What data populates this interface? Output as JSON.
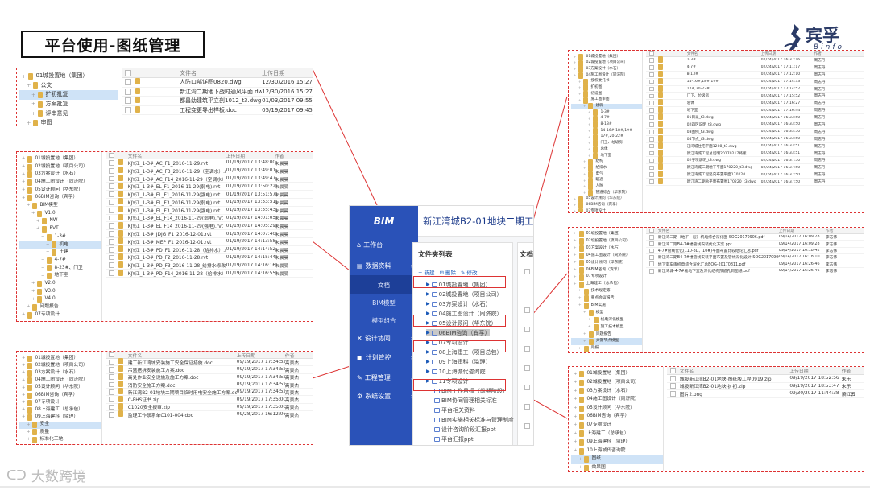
{
  "slide_title": "平台使用-图纸管理",
  "logo": {
    "name": "宾孚",
    "sub": "Binfo"
  },
  "watermark": "大数跨境",
  "colors": {
    "accent_red": "#d33333",
    "sidebar_blue": "#2a52b8",
    "folder": "#e0b24a",
    "selected_row": "#cfe3f7"
  },
  "app": {
    "logo_text": "BIM",
    "project_title": "新江湾城B2-01地块二期工程",
    "menu": [
      {
        "label": "工作台",
        "icon": "home-icon"
      },
      {
        "label": "数据资料",
        "icon": "database-icon"
      },
      {
        "label": "文档",
        "sub": true,
        "active": true
      },
      {
        "label": "BIM模型",
        "sub": true
      },
      {
        "label": "模型组合",
        "sub": true
      },
      {
        "label": "设计协同",
        "icon": "collab-icon"
      },
      {
        "label": "计划管控",
        "icon": "plan-icon"
      },
      {
        "label": "工程管理",
        "icon": "wrench-icon"
      },
      {
        "label": "系统设置",
        "icon": "gear-icon"
      }
    ],
    "tree_title": "文件夹列表",
    "right_title": "文档",
    "tools": {
      "add": "新建",
      "delete": "删除",
      "edit": "修改"
    },
    "nodes": [
      "01城投置地（集团）",
      "02城投置地（项目公司）",
      "03方案设计（水石）",
      "04施工图设计（同济院）",
      "05设计顾问（华东院）",
      "06BIM咨询（宾孚）",
      "07专项设计",
      "08上海建工（项目总包）",
      "09上海建科（监理）",
      "10上海城代咨询院",
      "11专项设计",
      "BIM工作月报（前期阶段）",
      "BIM协同管理相关标准",
      "平台相关资料",
      "BIM实施相关标准与管理制度",
      "设计咨询阶段汇报ppt",
      "平台汇报ppt"
    ]
  },
  "panel1": {
    "tree": [
      "01城投置地（集团）",
      "公文",
      "扩初批复",
      "方案批复",
      "评审意见",
      "审图"
    ],
    "headers": [
      "文件名",
      "上传日期"
    ],
    "rows": [
      [
        "人防口部详图0820.dwg",
        "12/30/2016 15:27:06"
      ],
      [
        "新江湾二期地下战时通风平面.dwg",
        "12/30/2016 15:27:06"
      ],
      [
        "都昌幼建筑平立剖1012_t3.dwg",
        "01/03/2017 09:55:37"
      ],
      [
        "工程变更导出样板.doc",
        "05/19/2017 09:45:14"
      ]
    ]
  },
  "panel2": {
    "tree": [
      "01城投置地（集团）",
      "02城投置地（项目公司）",
      "03方案设计（水石）",
      "04施工图设计（同济院）",
      "05设计顾问（华东院）",
      "06BIM咨询（宾孚）",
      "BIM模型",
      "V1.0",
      "NW",
      "RVT",
      "1-3#",
      "机电",
      "土建",
      "4-7#",
      "8-23#、门卫",
      "地下室",
      "V2.0",
      "V3.0",
      "V4.0",
      "问题报告",
      "07专项设计"
    ],
    "headers": [
      "文件名",
      "上传日期",
      "作者"
    ],
    "rows": [
      [
        "KJY江_1-3#_AC_F1_2016-11-29.rvt",
        "01/19/2017 13:48:00",
        "朱晨曼"
      ],
      [
        "KJY江_1-3#_AC_F3_2016-11-29（空调水）.rvt",
        "01/19/2017 13:49:01",
        "朱晨曼"
      ],
      [
        "KJY江_1-3#_AC_F14_2016-11-29（空调水）.rvt",
        "01/19/2017 13:49:47",
        "朱晨曼"
      ],
      [
        "KJY江_1-3#_EL_F1_2016-11-29(弱电).rvt",
        "01/19/2017 13:50:22",
        "朱晨曼"
      ],
      [
        "KJY江_1-3#_EL_F1_2016-11-29(强电).rvt",
        "01/19/2017 13:51:57",
        "朱晨曼"
      ],
      [
        "KJY江_1-3#_EL_F3_2016-11-29(弱电).rvt",
        "01/19/2017 13:53:51",
        "朱晨曼"
      ],
      [
        "KJY江_1-3#_EL_F3_2016-11-29(强电).rvt",
        "01/19/2017 13:55:43",
        "朱晨曼"
      ],
      [
        "KJY江_1-3#_EL_F14_2016-11-29(弱电).rvt",
        "01/19/2017 14:01:05",
        "朱晨曼"
      ],
      [
        "KJY江_1-3#_EL_F14_2016-11-29(强电).rvt",
        "01/19/2017 14:05:29",
        "朱晨曼"
      ],
      [
        "KJY江_1-3#_JDJG_F1_2016-12-01.rvt",
        "01/19/2017 14:07:40",
        "朱晨曼"
      ],
      [
        "KJY江_1-3#_MEP_F1_2016-12-01.rvt",
        "01/19/2017 14:13:58",
        "朱晨曼"
      ],
      [
        "KJY江_1-3#_PD_F1_2016-11-28（给排水）.rvt",
        "01/19/2017 14:14:52",
        "朱晨曼"
      ],
      [
        "KJY江_1-3#_PD_F2_2016-11-28.rvt",
        "01/19/2017 14:15:44",
        "朱晨曼"
      ],
      [
        "KJY江_1-3#_PD_F3_2016-11-28_给排水修改.rvt",
        "01/19/2017 14:16:16",
        "朱晨曼"
      ],
      [
        "KJY江_1-3#_PD_F14_2016-11-28（给排水）.rvt",
        "01/19/2017 14:16:55",
        "朱晨曼"
      ]
    ]
  },
  "panel3": {
    "tree": [
      "01城投置地（集团）",
      "02城投置地（项目公司）",
      "03方案设计（水石）",
      "04施工图设计（同济院）",
      "05设计顾问（华东院）",
      "06BIM咨询（宾孚）",
      "07专项设计",
      "08上海建工（总承包）",
      "09上海建科（监理）",
      "安全",
      "质量",
      "标准化工地"
    ],
    "headers": [
      "文件名",
      "上传日期",
      "作者"
    ],
    "rows": [
      [
        "建工新江湾城安装施工安全保证措施.doc",
        "09/19/2017 17:34:52",
        "高景杰"
      ],
      [
        "吊篮搭拆安装施工方案.doc",
        "09/19/2017 17:34:52",
        "高景杰"
      ],
      [
        "高处作业安全设施及施工方案.doc",
        "09/19/2017 17:34:52",
        "高景杰"
      ],
      [
        "消防安全施工方案.doc",
        "09/19/2017 17:34:52",
        "高景杰"
      ],
      [
        "新江湾B2-01地块二期项目临时用电安全施工方案.doc",
        "09/19/2017 17:34:52",
        "高景杰"
      ],
      [
        "C-FHS证书.zip",
        "09/19/2017 17:35:00",
        "高景杰"
      ],
      [
        "C1020安全报审.zip",
        "09/19/2017 17:35:00",
        "高景杰"
      ],
      [
        "监理工作联系单C101-004.doc",
        "09/28/2017 16:12:06",
        "高景杰"
      ]
    ]
  },
  "panel4": {
    "tree": [
      "01城投置地（集团）",
      "02城投置地（项目公司）",
      "03方案设计（水石）",
      "04施工图设计（同济院）",
      "授权委托书",
      "扩初图",
      "初设图",
      "施工图审图",
      "建筑",
      "1-3#",
      "4-7#",
      "8-13#",
      "14-16#,18#,19#",
      "17#,20-22#",
      "门卫、垃圾房",
      "总体",
      "地下室",
      "结构",
      "给排水",
      "电气",
      "暖通",
      "人防",
      "管道综合（华东院）",
      "05设计顾问（华东院）",
      "06BIM咨询（宾孚）",
      "07专项设计"
    ],
    "headers": [
      "文件名",
      "上传日期",
      "作者"
    ],
    "rows": [
      [
        "1-3#",
        "02/24/2017 16:37:16",
        "周志丹"
      ],
      [
        "4-7#",
        "02/24/2017 17:11:17",
        "周志丹"
      ],
      [
        "8-13#",
        "02/24/2017 17:12:10",
        "周志丹"
      ],
      [
        "14-16#,18#,19#",
        "02/24/2017 17:14:33",
        "周志丹"
      ],
      [
        "17#,20-22#",
        "02/24/2017 17:14:52",
        "周志丹"
      ],
      [
        "门卫、垃圾房",
        "02/24/2017 17:15:52",
        "周志丹"
      ],
      [
        "总体",
        "02/24/2017 17:16:27",
        "周志丹"
      ],
      [
        "地下室",
        "02/24/2017 17:16:44",
        "周志丹"
      ],
      [
        "01目录_t3.dwg",
        "02/24/2017 16:33:50",
        "周志丹"
      ],
      [
        "02四区说明_t3.dwg",
        "02/24/2017 16:33:50",
        "周志丹"
      ],
      [
        "03图例_t3.dwg",
        "02/24/2017 16:33:50",
        "周志丹"
      ],
      [
        "04节点_t3.dwg",
        "02/24/2017 16:33:50",
        "周志丹"
      ],
      [
        "江湾城住宅平面1208_t3.dwg",
        "02/24/2017 16:33:51",
        "周志丹"
      ],
      [
        "新江湾城工程总说明20170217终版",
        "02/24/2017 16:33:51",
        "周志丹"
      ],
      [
        "02子项说明_t3.dwg",
        "02/24/2017 16:37:50",
        "周志丹"
      ],
      [
        "新江湾城二期地下平面170220_t3.dwg",
        "02/24/2017 16:37:50",
        "周志丹"
      ],
      [
        "新江湾城工程竖向布置平面170220",
        "02/24/2017 16:37:50",
        "周志丹"
      ],
      [
        "新江湾二期总平面布置图170220_t3.dwg",
        "02/24/2017 16:37:50",
        "周志丹"
      ]
    ]
  },
  "panel5": {
    "tree": [
      "01城投置地（集团）",
      "02城投置地（项目公司）",
      "03方案设计（水石）",
      "04施工图设计（同济院）",
      "05设计顾问（华东院）",
      "06BIM咨询（宾孚）",
      "07专项设计",
      "上海建工（总承包）",
      "技术规定等",
      "重点会议报告",
      "BIM实施",
      "模型",
      "机电深化模型",
      "施工技术模型",
      "问题报告",
      "关键节点模型",
      "月报"
    ],
    "headers": [
      "文件名",
      "上传日期",
      "作者"
    ],
    "rows": [
      [
        "新江湾二期（地下一层）机电综合深化图-SOG20170906.pdf",
        "09/14/2017 16:09:28",
        "李志伟"
      ],
      [
        "新江湾二期B4-7#楼管线安装优化方案.ppt",
        "09/14/2017 16:09:28",
        "李志伟"
      ],
      [
        "4-7#管线优化(110-8D、10#)平面布置比较结论汇总.pdf",
        "09/14/2017 16:18:42",
        "李志伟"
      ],
      [
        "新江湾二期B4-7#楼管线安装平面布置及管线深化设计-SOG20170906.pdf",
        "09/14/2017 16:18:10",
        "李志伟"
      ],
      [
        "地下室车库机电综合深化汇总BOG-20170811.pdf",
        "09/14/2017 16:26:46",
        "李志伟"
      ],
      [
        "新江湾城-4-7#楼地下室及深化结构预留孔洞图纸.pdf",
        "09/14/2017 16:26:46",
        "李志伟"
      ]
    ]
  },
  "panel6": {
    "tree": [
      "01城投置地（集团）",
      "02城投置地（项目公司）",
      "03方案设计（水石）",
      "04施工图设计（同济院）",
      "05设计顾问（华东院）",
      "06BIM咨询（宾孚）",
      "07专项设计",
      "上海建工（总承包）",
      "09上海建科（监理）",
      "10上海城代咨询院",
      "图纸",
      "效果图"
    ],
    "headers": [
      "文件名",
      "上传日期",
      "作者"
    ],
    "rows": [
      [
        "城投新江湾B2-01地块-图纸版工程0919.zip",
        "09/19/2017 18:52:56",
        "朱乐"
      ],
      [
        "城投新江湾B2-01地块-扩初.zip",
        "09/19/2017 18:53:47",
        "朱乐"
      ],
      [
        "图片2.png",
        "09/30/2017 11:44:38",
        "萧红云"
      ]
    ]
  }
}
